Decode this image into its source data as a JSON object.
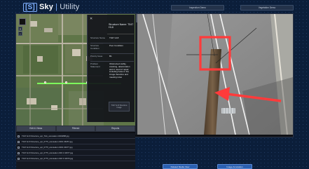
{
  "app": {
    "logo_mark": "[S]",
    "brand": "Sky",
    "separator": "|",
    "product": "Utility"
  },
  "header": {
    "inspection_demo": "Inspection Demo",
    "vegetation_demo": "Vegetation Demo"
  },
  "info_panel": {
    "title": "Structure Name: T047 HI-8",
    "rows": [
      {
        "key": "Structure Name",
        "value": "T047 HI-8"
      },
      {
        "key": "Structure Condition",
        "value": "Poor Condition"
      },
      {
        "key": "Priority Issue",
        "value": "B1"
      },
      {
        "key": "Problem Statement",
        "value": "Obstructed visibly, cracking, deterioration and in need of repair, including holes in the image therefore and meeting rules"
      }
    ],
    "image_caption": "T047 HI-8 Structure Image"
  },
  "map_tools": {
    "buttons": [
      "Edit & Views",
      "Filtered",
      "Reports"
    ]
  },
  "files": [
    "T047 HI-8 Structure_opt_TAA_annotation 0004888.jpg",
    "T047 HI-8 Structure_opt_0775_annotation 0001 06057.jpg",
    "T047 HI-8 Structure_opt_0775_annotation 0001 04677.jpg",
    "T047 HI-8 Structure_opt_0775_annotation 000 2 04677.jpg",
    "T047 HI-8 Structure_opt_0775_annotation 000 3 04670.jpg"
  ],
  "bottom": {
    "related_media": "Related Media View",
    "image_annotation": "Image Annotation"
  },
  "colors": {
    "background": "#0b1e3a",
    "accent": "#2a5fb0",
    "highlight": "#ff3b3b",
    "route": "#7dff5c"
  }
}
